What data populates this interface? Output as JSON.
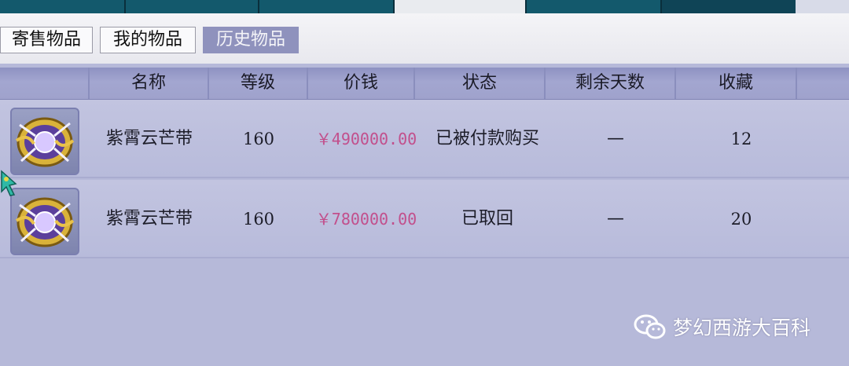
{
  "sub_tabs": [
    {
      "label": "寄售物品",
      "active": false
    },
    {
      "label": "我的物品",
      "active": false
    },
    {
      "label": "历史物品",
      "active": true
    }
  ],
  "table": {
    "columns": [
      "",
      "名称",
      "等级",
      "价钱",
      "状态",
      "剩余天数",
      "收藏"
    ],
    "rows": [
      {
        "icon": "purple-orb-item-icon",
        "name": "紫霄云芒带",
        "level": "160",
        "price": "￥490000.00",
        "status": "已被付款购买",
        "days_left": "—",
        "favorites": "12"
      },
      {
        "icon": "purple-orb-item-icon",
        "name": "紫霄云芒带",
        "level": "160",
        "price": "￥780000.00",
        "status": "已取回",
        "days_left": "—",
        "favorites": "20"
      }
    ]
  },
  "watermark": {
    "icon": "wechat-icon",
    "text": "梦幻西游大百科"
  },
  "colors": {
    "price": "#c24f8c",
    "header_bg": "#9fa2cc",
    "active_tab": "#8f92bd",
    "nav_bg": "#0f4456"
  }
}
